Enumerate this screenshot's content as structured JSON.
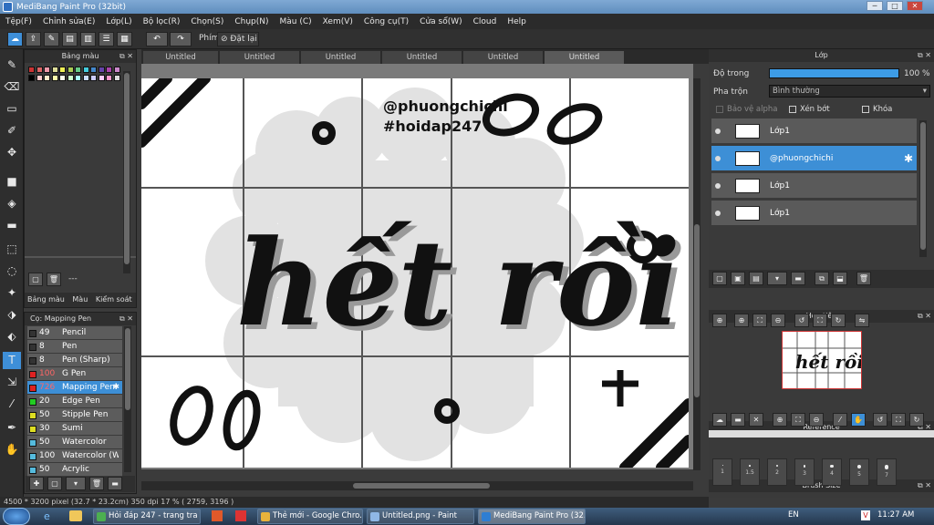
{
  "window": {
    "title": "MediBang Paint Pro (32bit)",
    "controls": [
      "─",
      "□",
      "✕"
    ]
  },
  "menu": [
    "Tệp(F)",
    "Chỉnh sửa(E)",
    "Lớp(L)",
    "Bộ lọc(R)",
    "Chọn(S)",
    "Chụp(N)",
    "Màu (C)",
    "Xem(V)",
    "Công cụ(T)",
    "Cửa sổ(W)",
    "Cloud",
    "Help"
  ],
  "toolbar": {
    "shortcut_label": "Phím",
    "reset_label": "Đặt lại"
  },
  "palette": {
    "title": "Bảng màu",
    "row1": [
      "#c33",
      "#d66",
      "#e9a",
      "#dd9",
      "#ee5",
      "#ac5",
      "#6c8",
      "#4cd",
      "#48c",
      "#64a",
      "#a4a",
      "#c8c"
    ],
    "row2": [
      "#000",
      "#fcc",
      "#fec",
      "#ffa",
      "#ffe",
      "#cfc",
      "#aff",
      "#cdf",
      "#ccf",
      "#fcf",
      "#f9c",
      "#ddd"
    ],
    "tabs": [
      "Bảng màu",
      "Màu",
      "Kiểm soát cọ"
    ],
    "footer_text": "---"
  },
  "brush": {
    "title": "Cọ: Mapping Pen",
    "items": [
      {
        "size": "49",
        "name": "Pencil",
        "color": "#333"
      },
      {
        "size": "8",
        "name": "Pen",
        "color": "#333"
      },
      {
        "size": "8",
        "name": "Pen (Sharp)",
        "color": "#333"
      },
      {
        "size": "100",
        "name": "G Pen",
        "color": "#d22"
      },
      {
        "size": "726",
        "name": "Mapping Pen",
        "color": "#d22"
      },
      {
        "size": "20",
        "name": "Edge Pen",
        "color": "#2c2"
      },
      {
        "size": "50",
        "name": "Stipple Pen",
        "color": "#dd2"
      },
      {
        "size": "30",
        "name": "Sumi",
        "color": "#dd2"
      },
      {
        "size": "50",
        "name": "Watercolor",
        "color": "#5bd"
      },
      {
        "size": "100",
        "name": "Watercolor (We",
        "color": "#5bd"
      },
      {
        "size": "50",
        "name": "Acrylic",
        "color": "#5bd"
      }
    ]
  },
  "tabs": [
    "Untitled",
    "Untitled",
    "Untitled",
    "Untitled",
    "Untitled",
    "Untitled"
  ],
  "artwork": {
    "line1": "@phuongchichi",
    "line2": "#hoidap247",
    "main": "hết rồi"
  },
  "layer_panel": {
    "title": "Lớp",
    "opacity_label": "Độ trong",
    "opacity_value": "100 %",
    "opacity": 1.0,
    "blend_label": "Pha trộn",
    "blend_value": "Bình thường",
    "protect_alpha": "Bảo vệ alpha",
    "clipping": "Xén bớt",
    "lock": "Khóa",
    "layers": [
      {
        "name": "Lớp1",
        "selected": false
      },
      {
        "name": "@phuongchichi",
        "selected": true
      },
      {
        "name": "Lớp1",
        "selected": false
      },
      {
        "name": "Lớp1",
        "selected": false
      }
    ]
  },
  "navigator": {
    "title": "Hoa tiêu"
  },
  "reference": {
    "title": "Reference"
  },
  "brush_size": {
    "title": "Brush Size",
    "sizes": [
      "1",
      "1.5",
      "2",
      "3",
      "4",
      "5",
      "7"
    ]
  },
  "status": {
    "text": "4500 * 3200 pixel  (32.7 * 23.2cm)  350 dpi  17 %  ( 2759, 3196 )"
  },
  "taskbar": {
    "items": [
      "Hỏi đáp 247 - trang tra ...",
      "Thẻ mới - Google Chro...",
      "Untitled.png - Paint",
      "MediBang Paint Pro (32..."
    ],
    "lang": "EN",
    "clock": "11:27 AM"
  }
}
